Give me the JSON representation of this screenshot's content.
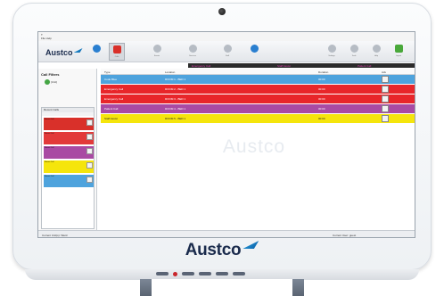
{
  "menu": {
    "title": "T",
    "items": "File Help"
  },
  "brand": {
    "name": "Austco"
  },
  "toolbar": {
    "buttons": [
      {
        "label": ""
      },
      {
        "label": "Calls"
      },
      {
        "label": "Events"
      },
      {
        "label": "Services"
      },
      {
        "label": "Staff"
      },
      {
        "label": ""
      },
      {
        "label": "Settings"
      },
      {
        "label": "Tools"
      },
      {
        "label": "Help"
      },
      {
        "label": "Logout"
      }
    ]
  },
  "ticker": {
    "messages": [
      "Emergency Call",
      "Staff Assist",
      "Patient Call"
    ]
  },
  "left_pane": {
    "title": "Call Filters",
    "unit": "[Unit]",
    "recent_title": "Recent Calls",
    "recent_subtitle": "",
    "recent": [
      {
        "text": "Recent Call",
        "color": "#d9302a"
      },
      {
        "text": "Recent Call",
        "color": "#e23a3a"
      },
      {
        "text": "Recent Call",
        "color": "#a94aa3"
      },
      {
        "text": "Recent Call",
        "color": "#f5e50c"
      },
      {
        "text": "Recent Call",
        "color": "#4ea3dd"
      }
    ]
  },
  "table": {
    "headers": {
      "type": "Type",
      "location": "Location",
      "duration": "Duration",
      "ack": "Ack"
    },
    "rows": [
      {
        "type": "Code Blue",
        "location": "ROOM 1 - BED 1",
        "duration": "00:00",
        "ack_label": "",
        "color": "#4ea3dd",
        "text_color": "#ffffff"
      },
      {
        "type": "Emergency Call",
        "location": "ROOM 2 - BED 1",
        "duration": "00:00",
        "ack_label": "",
        "color": "#e8262a",
        "text_color": "#ffffff"
      },
      {
        "type": "Emergency Call",
        "location": "ROOM 3 - BED 1",
        "duration": "00:00",
        "ack_label": "",
        "color": "#e8262a",
        "text_color": "#ffffff"
      },
      {
        "type": "Patient Call",
        "location": "ROOM 4 - BED 1",
        "duration": "00:00",
        "ack_label": "",
        "color": "#a94aa3",
        "text_color": "#ffffff"
      },
      {
        "type": "Staff Assist",
        "location": "ROOM 5 - BED 1",
        "duration": "00:00",
        "ack_label": "",
        "color": "#f5e50c",
        "text_color": "#222222"
      }
    ]
  },
  "watermark": "Austco",
  "status": {
    "left": "Current Unit(s): Ward",
    "middle": "",
    "right": "Current User: guest"
  }
}
